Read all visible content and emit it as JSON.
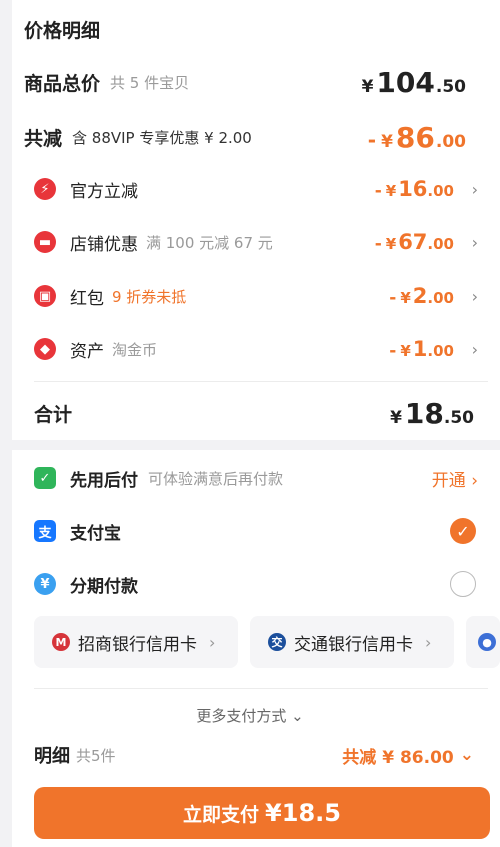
{
  "price_detail": {
    "title": "价格明细",
    "goods_total": {
      "label": "商品总价",
      "sub": "共 5 件宝贝",
      "yen": "¥",
      "int": "104",
      "dec": ".50"
    },
    "discount_total": {
      "label": "共减",
      "sub": "含 88VIP 专享优惠 ¥ 2.00",
      "minus": "-",
      "yen": "¥",
      "int": "86",
      "dec": ".00"
    },
    "items": [
      {
        "name": "官方立减",
        "desc": "",
        "minus": "-",
        "yen": "¥",
        "int": "16",
        "dec": ".00",
        "icon": "bolt-icon"
      },
      {
        "name": "店铺优惠",
        "desc": "满 100 元减 67 元",
        "minus": "-",
        "yen": "¥",
        "int": "67",
        "dec": ".00",
        "icon": "shop-icon"
      },
      {
        "name": "红包",
        "desc": "9 折券未抵",
        "minus": "-",
        "yen": "¥",
        "int": "2",
        "dec": ".00",
        "icon": "red-packet-icon"
      },
      {
        "name": "资产",
        "desc": "淘金币",
        "minus": "-",
        "yen": "¥",
        "int": "1",
        "dec": ".00",
        "icon": "coin-tag-icon"
      }
    ],
    "total": {
      "label": "合计",
      "yen": "¥",
      "int": "18",
      "dec": ".50"
    }
  },
  "payment": {
    "pay_later": {
      "name": "先用后付",
      "desc": "可体验满意后再付款",
      "action": "开通 ›"
    },
    "alipay": {
      "name": "支付宝",
      "icon_char": "支",
      "checked_mark": "✓"
    },
    "installment": {
      "name": "分期付款"
    },
    "cards": [
      {
        "name": "招商银行信用卡",
        "chev": "›"
      },
      {
        "name": "交通银行信用卡",
        "chev": "›"
      }
    ],
    "more": "更多支付方式 ⌄",
    "summary": {
      "title": "明细",
      "count": "共5件",
      "discount": "共减 ¥ 86.00",
      "expand": "⌄"
    },
    "pay_button": {
      "label": "立即支付",
      "amount": "¥18.5"
    }
  },
  "colors": {
    "accent": "#f0742b",
    "red_icon": "#e8353a",
    "alipay_blue": "#1677ff"
  }
}
